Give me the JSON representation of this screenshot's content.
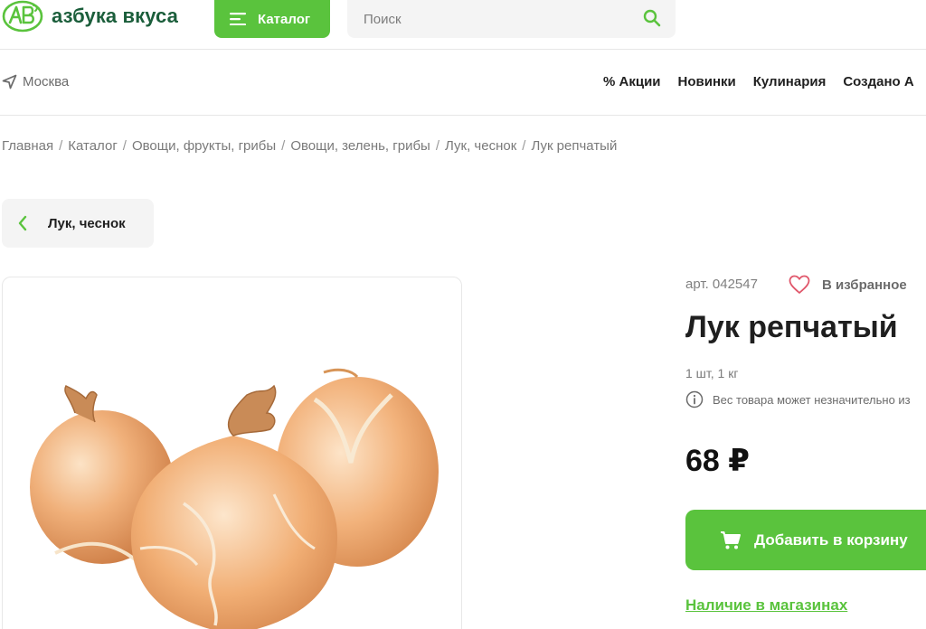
{
  "header": {
    "brand_name": "азбука вкуса",
    "catalog_label": "Каталог",
    "search_placeholder": "Поиск",
    "accent_color": "#5ac33d",
    "brand_color": "#1b5e3b"
  },
  "subheader": {
    "city": "Москва",
    "nav": [
      "% Акции",
      "Новинки",
      "Кулинария",
      "Создано А"
    ]
  },
  "breadcrumb": [
    "Главная",
    "Каталог",
    "Овощи, фрукты, грибы",
    "Овощи, зелень, грибы",
    "Лук, чеснок",
    "Лук репчатый"
  ],
  "back_label": "Лук, чеснок",
  "product": {
    "article": "арт. 042547",
    "favorite_label": "В избранное",
    "title": "Лук репчатый",
    "pack": "1 шт, 1 кг",
    "weight_note": "Вес товара может незначительно из",
    "price": "68 ₽",
    "add_to_cart_label": "Добавить в корзину",
    "availability_label": "Наличие в магазинах"
  }
}
